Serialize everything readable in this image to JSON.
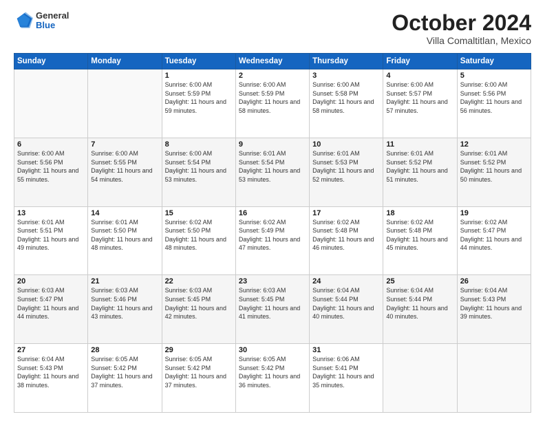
{
  "logo": {
    "general": "General",
    "blue": "Blue"
  },
  "header": {
    "month": "October 2024",
    "location": "Villa Comaltitlan, Mexico"
  },
  "weekdays": [
    "Sunday",
    "Monday",
    "Tuesday",
    "Wednesday",
    "Thursday",
    "Friday",
    "Saturday"
  ],
  "weeks": [
    [
      {
        "day": "",
        "info": ""
      },
      {
        "day": "",
        "info": ""
      },
      {
        "day": "1",
        "info": "Sunrise: 6:00 AM\nSunset: 5:59 PM\nDaylight: 11 hours and 59 minutes."
      },
      {
        "day": "2",
        "info": "Sunrise: 6:00 AM\nSunset: 5:59 PM\nDaylight: 11 hours and 58 minutes."
      },
      {
        "day": "3",
        "info": "Sunrise: 6:00 AM\nSunset: 5:58 PM\nDaylight: 11 hours and 58 minutes."
      },
      {
        "day": "4",
        "info": "Sunrise: 6:00 AM\nSunset: 5:57 PM\nDaylight: 11 hours and 57 minutes."
      },
      {
        "day": "5",
        "info": "Sunrise: 6:00 AM\nSunset: 5:56 PM\nDaylight: 11 hours and 56 minutes."
      }
    ],
    [
      {
        "day": "6",
        "info": "Sunrise: 6:00 AM\nSunset: 5:56 PM\nDaylight: 11 hours and 55 minutes."
      },
      {
        "day": "7",
        "info": "Sunrise: 6:00 AM\nSunset: 5:55 PM\nDaylight: 11 hours and 54 minutes."
      },
      {
        "day": "8",
        "info": "Sunrise: 6:00 AM\nSunset: 5:54 PM\nDaylight: 11 hours and 53 minutes."
      },
      {
        "day": "9",
        "info": "Sunrise: 6:01 AM\nSunset: 5:54 PM\nDaylight: 11 hours and 53 minutes."
      },
      {
        "day": "10",
        "info": "Sunrise: 6:01 AM\nSunset: 5:53 PM\nDaylight: 11 hours and 52 minutes."
      },
      {
        "day": "11",
        "info": "Sunrise: 6:01 AM\nSunset: 5:52 PM\nDaylight: 11 hours and 51 minutes."
      },
      {
        "day": "12",
        "info": "Sunrise: 6:01 AM\nSunset: 5:52 PM\nDaylight: 11 hours and 50 minutes."
      }
    ],
    [
      {
        "day": "13",
        "info": "Sunrise: 6:01 AM\nSunset: 5:51 PM\nDaylight: 11 hours and 49 minutes."
      },
      {
        "day": "14",
        "info": "Sunrise: 6:01 AM\nSunset: 5:50 PM\nDaylight: 11 hours and 48 minutes."
      },
      {
        "day": "15",
        "info": "Sunrise: 6:02 AM\nSunset: 5:50 PM\nDaylight: 11 hours and 48 minutes."
      },
      {
        "day": "16",
        "info": "Sunrise: 6:02 AM\nSunset: 5:49 PM\nDaylight: 11 hours and 47 minutes."
      },
      {
        "day": "17",
        "info": "Sunrise: 6:02 AM\nSunset: 5:48 PM\nDaylight: 11 hours and 46 minutes."
      },
      {
        "day": "18",
        "info": "Sunrise: 6:02 AM\nSunset: 5:48 PM\nDaylight: 11 hours and 45 minutes."
      },
      {
        "day": "19",
        "info": "Sunrise: 6:02 AM\nSunset: 5:47 PM\nDaylight: 11 hours and 44 minutes."
      }
    ],
    [
      {
        "day": "20",
        "info": "Sunrise: 6:03 AM\nSunset: 5:47 PM\nDaylight: 11 hours and 44 minutes."
      },
      {
        "day": "21",
        "info": "Sunrise: 6:03 AM\nSunset: 5:46 PM\nDaylight: 11 hours and 43 minutes."
      },
      {
        "day": "22",
        "info": "Sunrise: 6:03 AM\nSunset: 5:45 PM\nDaylight: 11 hours and 42 minutes."
      },
      {
        "day": "23",
        "info": "Sunrise: 6:03 AM\nSunset: 5:45 PM\nDaylight: 11 hours and 41 minutes."
      },
      {
        "day": "24",
        "info": "Sunrise: 6:04 AM\nSunset: 5:44 PM\nDaylight: 11 hours and 40 minutes."
      },
      {
        "day": "25",
        "info": "Sunrise: 6:04 AM\nSunset: 5:44 PM\nDaylight: 11 hours and 40 minutes."
      },
      {
        "day": "26",
        "info": "Sunrise: 6:04 AM\nSunset: 5:43 PM\nDaylight: 11 hours and 39 minutes."
      }
    ],
    [
      {
        "day": "27",
        "info": "Sunrise: 6:04 AM\nSunset: 5:43 PM\nDaylight: 11 hours and 38 minutes."
      },
      {
        "day": "28",
        "info": "Sunrise: 6:05 AM\nSunset: 5:42 PM\nDaylight: 11 hours and 37 minutes."
      },
      {
        "day": "29",
        "info": "Sunrise: 6:05 AM\nSunset: 5:42 PM\nDaylight: 11 hours and 37 minutes."
      },
      {
        "day": "30",
        "info": "Sunrise: 6:05 AM\nSunset: 5:42 PM\nDaylight: 11 hours and 36 minutes."
      },
      {
        "day": "31",
        "info": "Sunrise: 6:06 AM\nSunset: 5:41 PM\nDaylight: 11 hours and 35 minutes."
      },
      {
        "day": "",
        "info": ""
      },
      {
        "day": "",
        "info": ""
      }
    ]
  ]
}
